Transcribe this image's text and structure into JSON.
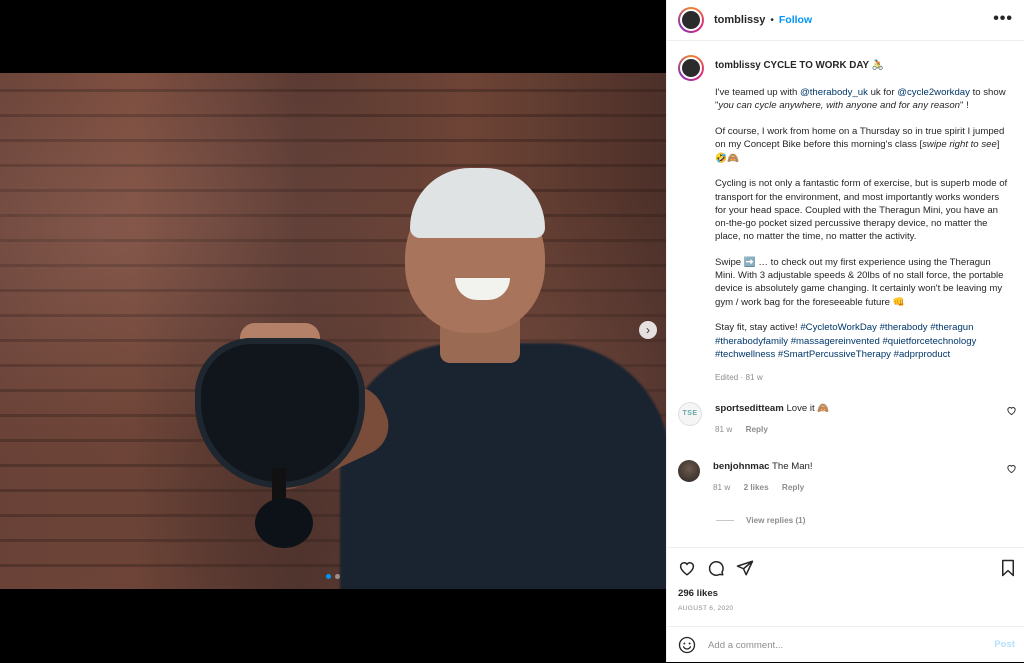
{
  "post": {
    "username": "tomblissy",
    "separator": "•",
    "follow": "Follow",
    "more": "•••",
    "next_arrow": "›"
  },
  "caption": {
    "username": "tomblissy",
    "title": "CYCLE TO WORK DAY 🚴",
    "p1_a": "I've teamed up with ",
    "p1_link1": "@therabody_uk",
    "p1_b": " uk for ",
    "p1_link2": "@cycle2workday",
    "p1_c": " to show \"",
    "p1_quote": "you can cycle anywhere, with anyone and for any reason",
    "p1_d": "\" !",
    "p2_a": "Of course, I work from home on a Thursday so in true spirit I jumped on my Concept Bike before this morning's class [",
    "p2_it": "swipe right to see",
    "p2_b": "] 🤣🙈",
    "p3": "Cycling is not only a fantastic form of exercise, but is superb mode of transport for the environment, and most importantly works wonders for your head space. Coupled with the Theragun Mini, you have an on-the-go pocket sized percussive therapy device, no matter the place, no matter the time, no matter the activity.",
    "p4": "Swipe ➡️ … to check out my first experience using the Theragun Mini. With 3 adjustable speeds & 20lbs of no stall force, the portable device is absolutely game changing. It certainly won't be leaving my gym / work bag for the foreseeable future 👊",
    "p5_a": "Stay fit, stay active! ",
    "p5_tags": "#CycletoWorkDay #therabody #theragun #therabodyfamily #massagereinvented #quietforcetechnology #techwellness #SmartPercussiveTherapy #adprproduct",
    "meta": "Edited · 81 w"
  },
  "comments": [
    {
      "avatar_text": "TSE",
      "username": "sportseditteam",
      "text": "Love it 🙈",
      "time": "81 w",
      "likes": "",
      "reply": "Reply"
    },
    {
      "avatar_text": "",
      "username": "benjohnmac",
      "text": "The Man!",
      "time": "81 w",
      "likes": "2 likes",
      "reply": "Reply"
    }
  ],
  "view_replies": "View replies (1)",
  "likes": "296 likes",
  "date": "AUGUST 6, 2020",
  "add_comment": {
    "placeholder": "Add a comment...",
    "post": "Post"
  },
  "carousel": {
    "count": 2,
    "active": 1
  }
}
